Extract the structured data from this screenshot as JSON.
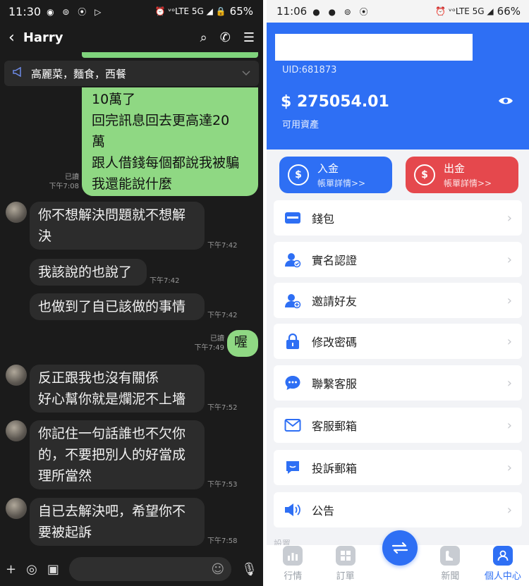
{
  "left": {
    "status": {
      "time": "11:30",
      "glyphs": "◉ ⊚ ⦿ ▷",
      "icons": "⏰ ᵛᵒLTE 5G ◢ 🔒",
      "battery": "65%"
    },
    "header": {
      "back": "‹",
      "name": "Harry",
      "actions": [
        "⌕",
        "✆",
        "☰"
      ]
    },
    "announcement": "高麗菜，麵食，西餐",
    "messages": [
      {
        "side": "me",
        "lines": [
          "10萬了",
          "回完訊息回去更高達20",
          "萬",
          "跟人借錢每個都說我被騙",
          "我還能說什麼"
        ],
        "read": "已讀",
        "time": "下午7:08"
      },
      {
        "side": "you",
        "lines": [
          "你不想解決問題就不想解",
          "決"
        ],
        "time": "下午7:42"
      },
      {
        "side": "you",
        "lines": [
          "我該說的也說了"
        ],
        "time": "下午7:42"
      },
      {
        "side": "you",
        "lines": [
          "也做到了自已該做的事情"
        ],
        "time": "下午7:42"
      },
      {
        "side": "me",
        "lines": [
          "喔"
        ],
        "read": "已讀",
        "time": "下午7:49"
      },
      {
        "side": "you",
        "lines": [
          "反正跟我也沒有關係",
          "好心幫你就是爛泥不上墻"
        ],
        "time": "下午7:52"
      },
      {
        "side": "you",
        "lines": [
          "你記住一句話誰也不欠你",
          "的，不要把別人的好當成",
          "理所當然"
        ],
        "time": "下午7:53"
      },
      {
        "side": "you",
        "lines": [
          "自已去解決吧，希望你不",
          "要被起訴"
        ],
        "time": "下午7:58"
      }
    ],
    "input_icons": [
      "+",
      "◎",
      "▣",
      "☺",
      "🎙"
    ]
  },
  "right": {
    "status": {
      "time": "11:06",
      "glyphs": "● ● ⊚ ⦿",
      "icons": "⏰ ᵛᵒLTE 5G ◢",
      "battery": "66%"
    },
    "uid": "UID:681873",
    "balance": "$ 275054.01",
    "balance_label": "可用資產",
    "deposit": {
      "title": "入金",
      "sub": "帳單詳情>>"
    },
    "withdraw": {
      "title": "出金",
      "sub": "帳單詳情>>"
    },
    "menu": [
      {
        "label": "錢包",
        "icon": "wallet-icon"
      },
      {
        "label": "實名認證",
        "icon": "verify-user-icon"
      },
      {
        "label": "邀請好友",
        "icon": "invite-user-icon"
      },
      {
        "label": "修改密碼",
        "icon": "lock-icon"
      },
      {
        "label": "聯繫客服",
        "icon": "chat-icon"
      },
      {
        "label": "客服郵箱",
        "icon": "mail-icon"
      },
      {
        "label": "投訴郵箱",
        "icon": "complaint-icon"
      },
      {
        "label": "公告",
        "icon": "speaker-icon"
      }
    ],
    "faded_label": "設置",
    "tabs": [
      {
        "label": "行情",
        "icon": "chart-icon"
      },
      {
        "label": "訂單",
        "icon": "orders-icon"
      },
      {
        "label": "",
        "icon": "swap-icon"
      },
      {
        "label": "新聞",
        "icon": "news-icon"
      },
      {
        "label": "個人中心",
        "icon": "profile-icon"
      }
    ],
    "colors": {
      "primary": "#2e6ff4",
      "danger": "#e5484d",
      "background": "#f2f3f6"
    }
  }
}
